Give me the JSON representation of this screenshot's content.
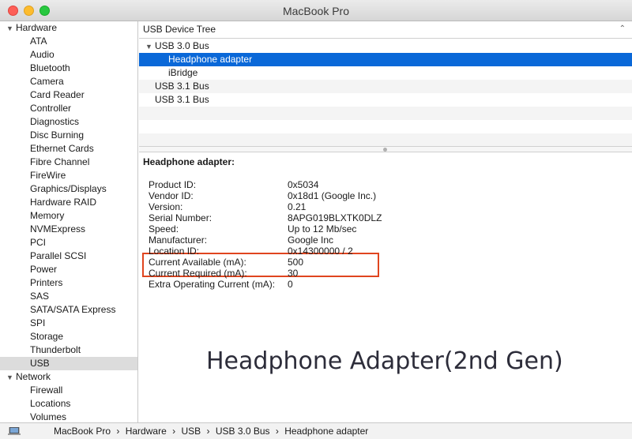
{
  "window": {
    "title": "MacBook Pro"
  },
  "sidebar": {
    "groups": [
      {
        "label": "Hardware",
        "items": [
          "ATA",
          "Audio",
          "Bluetooth",
          "Camera",
          "Card Reader",
          "Controller",
          "Diagnostics",
          "Disc Burning",
          "Ethernet Cards",
          "Fibre Channel",
          "FireWire",
          "Graphics/Displays",
          "Hardware RAID",
          "Memory",
          "NVMExpress",
          "PCI",
          "Parallel SCSI",
          "Power",
          "Printers",
          "SAS",
          "SATA/SATA Express",
          "SPI",
          "Storage",
          "Thunderbolt",
          "USB"
        ]
      },
      {
        "label": "Network",
        "items": [
          "Firewall",
          "Locations",
          "Volumes"
        ]
      }
    ],
    "selected": "USB"
  },
  "tree": {
    "header": "USB Device Tree",
    "rows": [
      {
        "label": "USB 3.0 Bus",
        "level": 0,
        "expanded": true
      },
      {
        "label": "Headphone adapter",
        "level": 1,
        "selected": true
      },
      {
        "label": "iBridge",
        "level": 1
      },
      {
        "label": "USB 3.1 Bus",
        "level": 0
      },
      {
        "label": "USB 3.1 Bus",
        "level": 0
      }
    ]
  },
  "detail": {
    "title": "Headphone adapter:",
    "properties": [
      {
        "key": "Product ID:",
        "value": "0x5034"
      },
      {
        "key": "Vendor ID:",
        "value": "0x18d1  (Google Inc.)"
      },
      {
        "key": "Version:",
        "value": "0.21"
      },
      {
        "key": "Serial Number:",
        "value": "8APG019BLXTK0DLZ"
      },
      {
        "key": "Speed:",
        "value": "Up to 12 Mb/sec"
      },
      {
        "key": "Manufacturer:",
        "value": "Google Inc"
      },
      {
        "key": "Location ID:",
        "value": "0x14300000 / 2"
      },
      {
        "key": "Current Available (mA):",
        "value": "500"
      },
      {
        "key": "Current Required (mA):",
        "value": "30"
      },
      {
        "key": "Extra Operating Current (mA):",
        "value": "0"
      }
    ]
  },
  "caption": "Headphone Adapter(2nd Gen)",
  "pathbar": {
    "crumbs": [
      "MacBook Pro",
      "USB",
      "USB 3.0 Bus",
      "Headphone adapter"
    ],
    "crumbs_hardware": "Hardware",
    "separator": "›"
  },
  "colors": {
    "selection": "#0a68d8",
    "highlight_box": "#e0451f"
  }
}
